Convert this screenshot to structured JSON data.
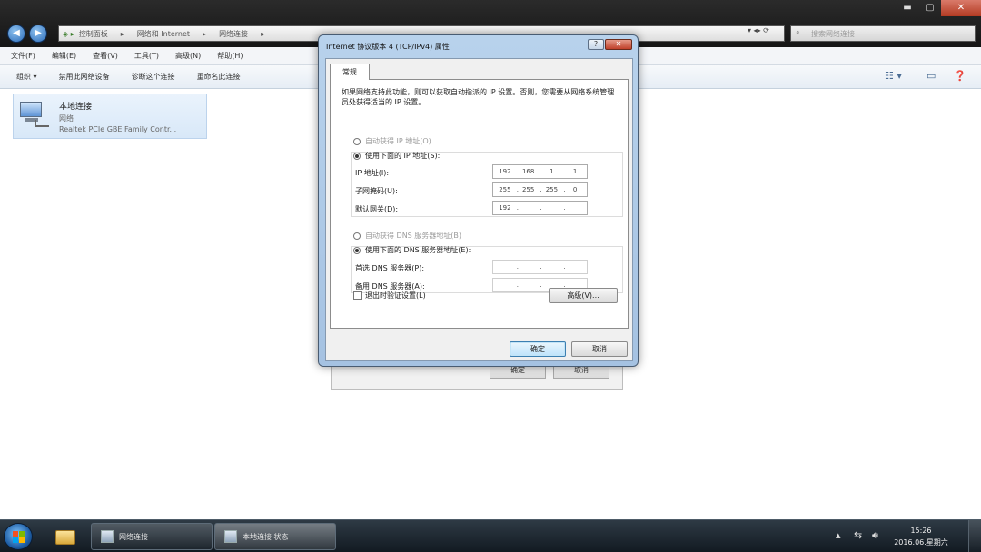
{
  "explorer": {
    "address": [
      "控制面板",
      "网络和 Internet",
      "网络连接"
    ],
    "search_placeholder": "搜索网络连接",
    "window_controls": {
      "minimize": "▬",
      "maximize": "▢",
      "close": "✕"
    },
    "menu": [
      "文件(F)",
      "编辑(E)",
      "查看(V)",
      "工具(T)",
      "高级(N)",
      "帮助(H)"
    ],
    "toolbar": [
      "组织 ▾",
      "禁用此网络设备",
      "诊断这个连接",
      "重命名此连接"
    ],
    "connection": {
      "name": "本地连接",
      "status": "网络",
      "adapter": "Realtek PCIe GBE Family Contr..."
    }
  },
  "background_dialog": {
    "ok": "确定",
    "cancel": "取消"
  },
  "dialog": {
    "title": "Internet 协议版本 4 (TCP/IPv4) 属性",
    "help": "?",
    "close": "✕",
    "tab": "常规",
    "description": "如果网络支持此功能，则可以获取自动指派的 IP 设置。否则，您需要从网络系统管理员处获得适当的 IP 设置。",
    "ip_auto": "自动获得 IP 地址(O)",
    "ip_manual": "使用下面的 IP 地址(S):",
    "ip_address_label": "IP 地址(I):",
    "ip_address": [
      "192",
      "168",
      "1",
      "1"
    ],
    "subnet_label": "子网掩码(U):",
    "subnet": [
      "255",
      "255",
      "255",
      "0"
    ],
    "gateway_label": "默认网关(D):",
    "gateway": [
      "192",
      "",
      "",
      ""
    ],
    "dns_auto": "自动获得 DNS 服务器地址(B)",
    "dns_manual": "使用下面的 DNS 服务器地址(E):",
    "dns_pref_label": "首选 DNS 服务器(P):",
    "dns_alt_label": "备用 DNS 服务器(A):",
    "validate_label": "退出时验证设置(L)",
    "advanced": "高级(V)...",
    "ok": "确定",
    "cancel": "取消"
  },
  "taskbar": {
    "tasks": [
      "网络连接",
      "本地连接 状态"
    ],
    "time": "15:26",
    "date": "2016.06.星期六"
  }
}
